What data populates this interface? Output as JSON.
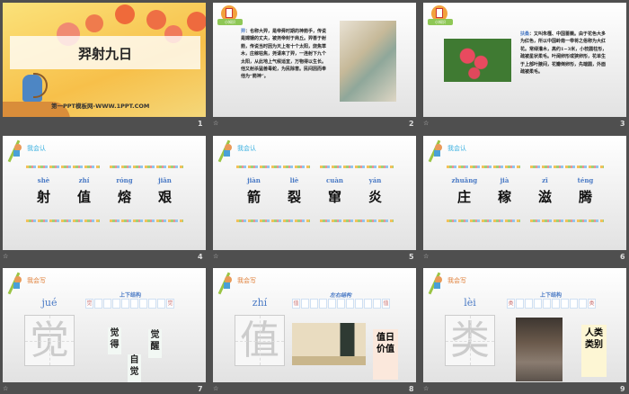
{
  "slides": [
    {
      "number": "1",
      "title": "羿射九日",
      "subtitle": "第一PPT模板网-WWW.1PPT.COM"
    },
    {
      "number": "2",
      "badge": "小知识",
      "term": "羿",
      "text": "：也称大羿，是帝舜时期的神箭手，传说是嫦娥的丈夫，被尧帝封于商丘。羿善于射箭，传说当时因为天上有十个太阳，烧焦草木，庄稼枯焦，尧请来了羿，一连射下九个太阳，从此地上气候适宜，万物得以生长。他又射杀猛兽毒蛇，为民除害。民间因而奉他为“箭神”。"
    },
    {
      "number": "3",
      "badge": "小知识",
      "term": "扶桑",
      "text": "：又叫朱槿、中国蔷薇。由于花色大多为红色，所以中国岭南一带将之俗称为大红花。常绿灌木，高约1~3米，小枝圆柱形，疏被星状柔毛。叶阔卵形或狭卵形，花单生于上部叶腋间，花瓣倒卵形，先端圆，外面疏被柔毛。"
    },
    {
      "number": "4",
      "section": "我会认",
      "chars": [
        {
          "py": "shè",
          "hz": "射"
        },
        {
          "py": "zhí",
          "hz": "值"
        },
        {
          "py": "róng",
          "hz": "熔"
        },
        {
          "py": "jiān",
          "hz": "艰"
        }
      ]
    },
    {
      "number": "5",
      "section": "我会认",
      "chars": [
        {
          "py": "jiàn",
          "hz": "箭"
        },
        {
          "py": "liè",
          "hz": "裂"
        },
        {
          "py": "cuàn",
          "hz": "窜"
        },
        {
          "py": "yán",
          "hz": "炎"
        }
      ]
    },
    {
      "number": "6",
      "section": "我会认",
      "chars": [
        {
          "py": "zhuāng",
          "hz": "庄"
        },
        {
          "py": "jià",
          "hz": "稼"
        },
        {
          "py": "zī",
          "hz": "滋"
        },
        {
          "py": "téng",
          "hz": "腾"
        }
      ]
    },
    {
      "number": "7",
      "section": "我会写",
      "pinyin": "jué",
      "char": "觉",
      "structure": "上下结构",
      "words": [
        "觉得",
        "觉醒",
        "自觉"
      ]
    },
    {
      "number": "8",
      "section": "我会写",
      "pinyin": "zhí",
      "char": "值",
      "structure": "左右结构",
      "words": [
        "值日",
        "价值"
      ]
    },
    {
      "number": "9",
      "section": "我会写",
      "pinyin": "lèi",
      "char": "类",
      "structure": "上下结构",
      "words": [
        "人类",
        "类别"
      ]
    }
  ],
  "slide_icon": "☆",
  "colors": {
    "background": "#4f4f4f",
    "pinyin": "#4a7ac5"
  }
}
